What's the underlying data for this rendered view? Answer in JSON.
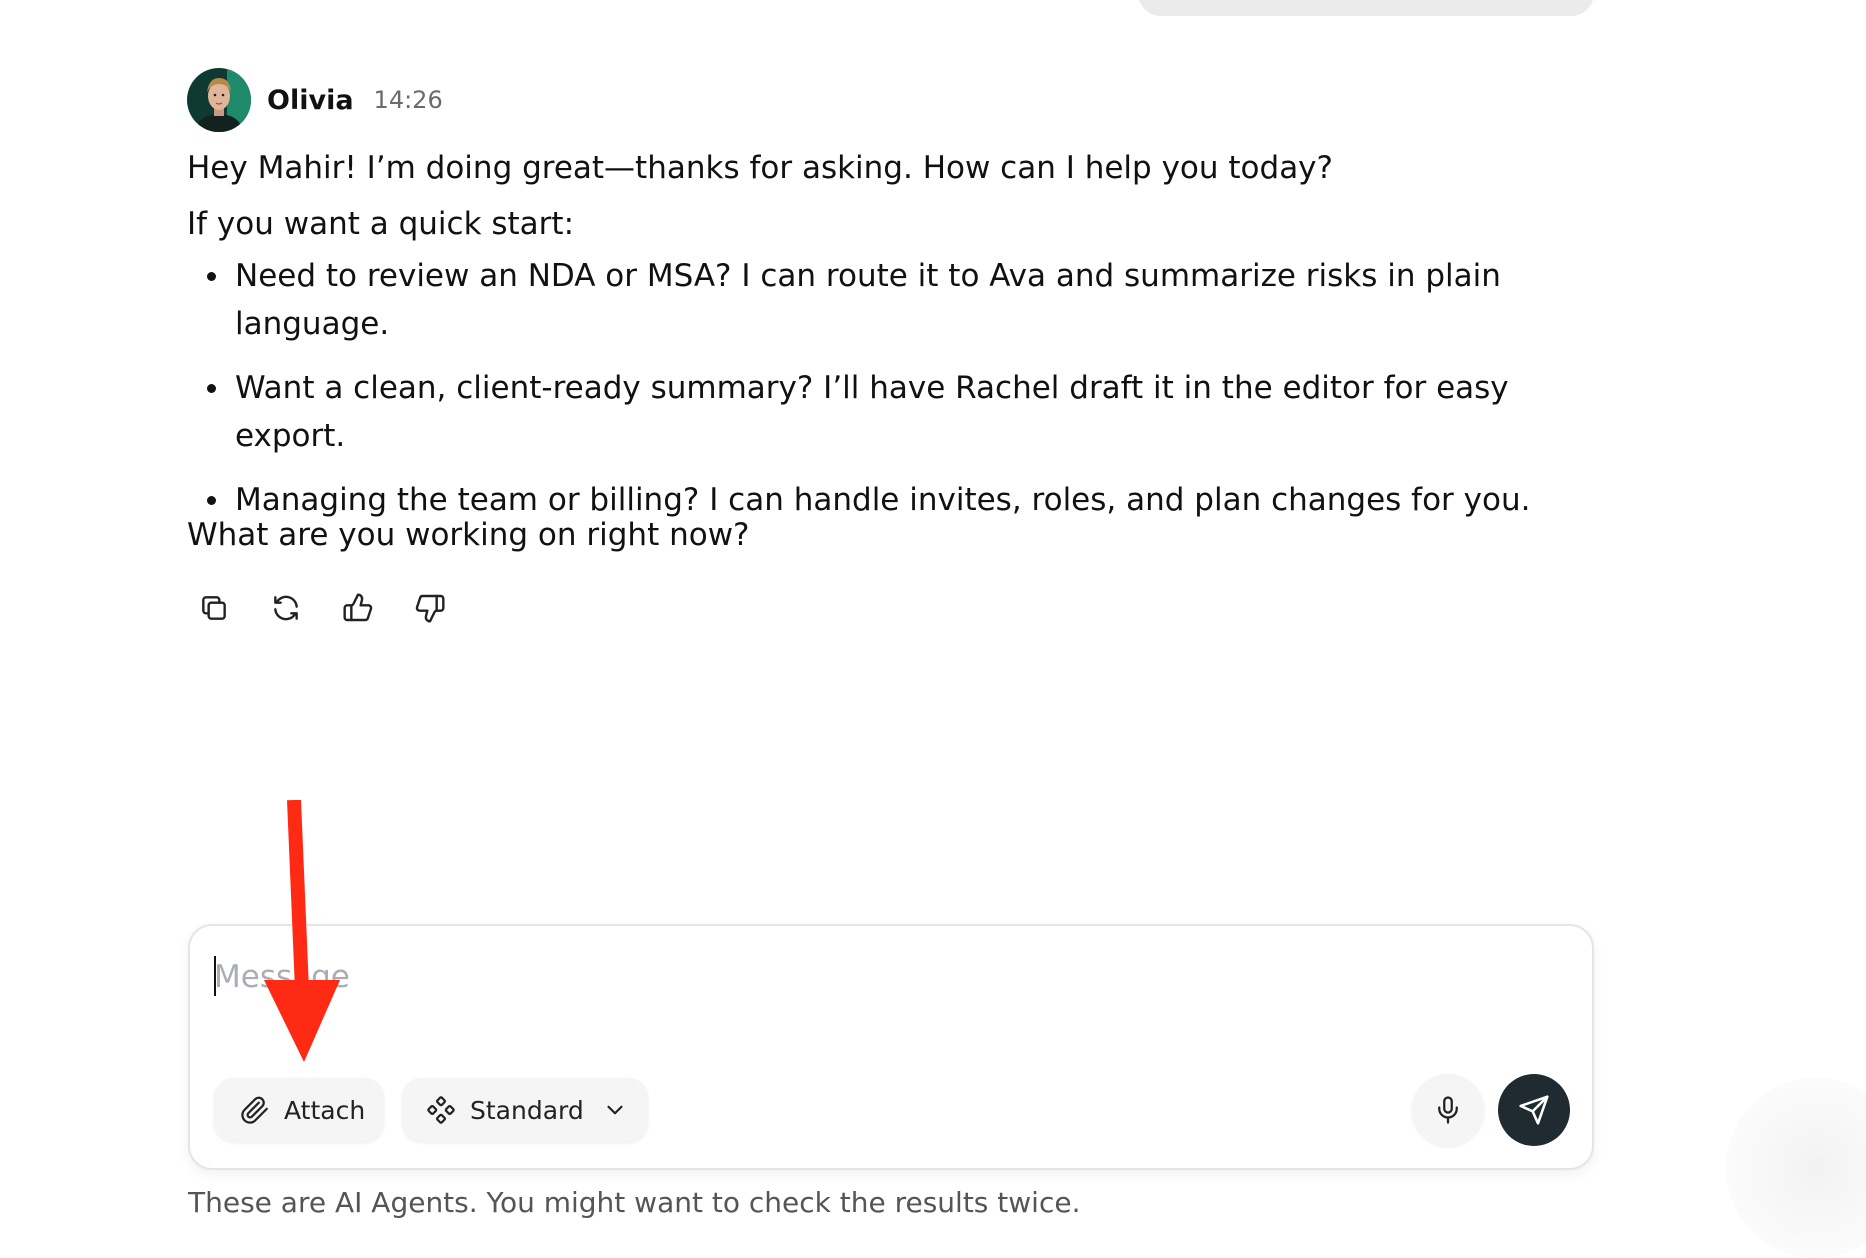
{
  "message": {
    "sender": "Olivia",
    "time": "14:26",
    "greeting": "Hey Mahir! I’m doing great—thanks for asking. How can I help you today?",
    "intro": "If you want a quick start:",
    "bullets": [
      "Need to review an NDA or MSA? I can route it to Ava and summarize risks in plain language.",
      "Want a clean, client-ready summary? I’ll have Rachel draft it in the editor for easy export.",
      "Managing the team or billing? I can handle invites, roles, and plan changes for you."
    ],
    "question": "What are you working on right now?",
    "actions": [
      "copy-icon",
      "regenerate-icon",
      "thumbs-up-icon",
      "thumbs-down-icon"
    ]
  },
  "composer": {
    "placeholder": "Message",
    "value": "",
    "attach_label": "Attach",
    "mode_label": "Standard"
  },
  "footer": {
    "disclaimer": "These are AI Agents. You might want to check the results twice."
  },
  "colors": {
    "send_button": "#1f2b30",
    "annotation_arrow": "#ff2a14",
    "placeholder": "#a9aeb6"
  }
}
